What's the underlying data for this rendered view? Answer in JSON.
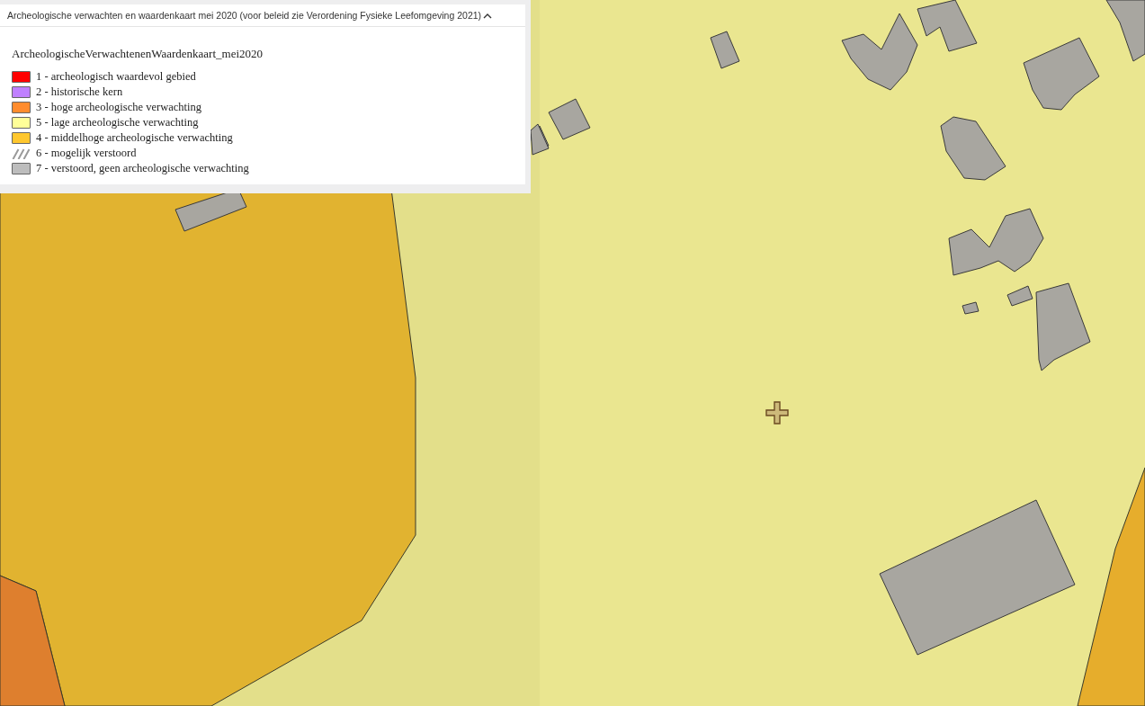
{
  "legend_panel": {
    "title": "Archeologische verwachten en waardenkaart mei 2020 (voor beleid zie Verordening Fysieke Leefomgeving 2021)",
    "expanded": true,
    "layer_name": "ArcheologischeVerwachtenenWaardenkaart_mei2020",
    "items": [
      {
        "label": "1 - archeologisch waardevol gebied",
        "kind": "fill",
        "color": "#ff0000"
      },
      {
        "label": "2 - historische kern",
        "kind": "fill",
        "color": "#bf80ff"
      },
      {
        "label": "3 - hoge archeologische verwachting",
        "kind": "fill",
        "color": "#ff8c2e"
      },
      {
        "label": "5 - lage archeologische verwachting",
        "kind": "fill",
        "color": "#ffff99"
      },
      {
        "label": "4 - middelhoge archeologische verwachting",
        "kind": "fill",
        "color": "#ffc72e"
      },
      {
        "label": "6 - mogelijk verstoord",
        "kind": "hatch",
        "color": "#9a9a9a"
      },
      {
        "label": "7 - verstoord, geen archeologische verwachting",
        "kind": "fill",
        "color": "#bdbdbd"
      }
    ]
  }
}
